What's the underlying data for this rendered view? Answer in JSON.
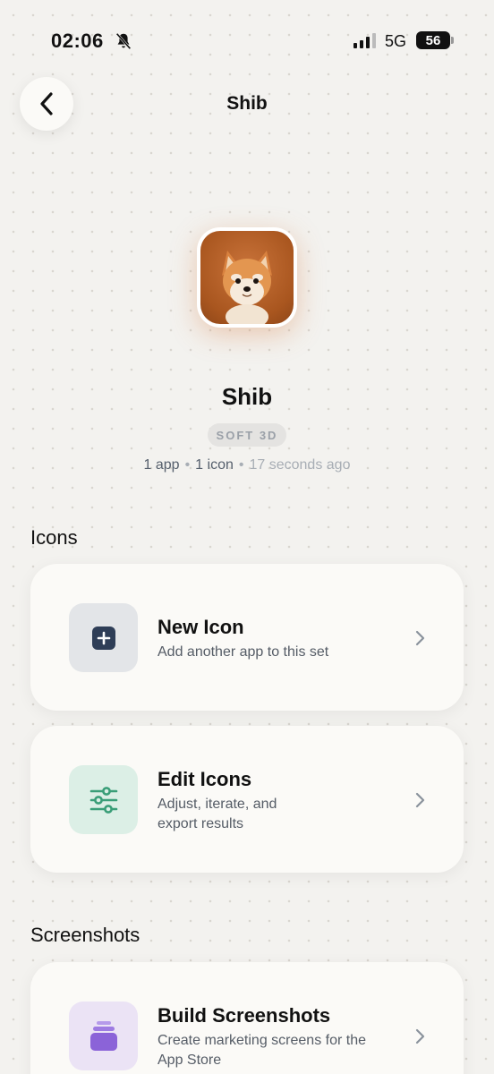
{
  "status": {
    "time": "02:06",
    "network": "5G",
    "battery": "56"
  },
  "nav": {
    "title": "Shib"
  },
  "app": {
    "name": "Shib",
    "style": "SOFT 3D",
    "apps": "1 app",
    "icons": "1 icon",
    "updated": "17 seconds ago"
  },
  "sections": {
    "icons_title": "Icons",
    "screenshots_title": "Screenshots"
  },
  "cards": {
    "new_icon": {
      "title": "New Icon",
      "subtitle": "Add another app to this set"
    },
    "edit_icons": {
      "title": "Edit Icons",
      "subtitle": "Adjust, iterate, and export results"
    },
    "build_screenshots": {
      "title": "Build Screenshots",
      "subtitle": "Create marketing screens for the App Store"
    }
  },
  "icons": {
    "back": "chevron-left-icon",
    "bell": "bell-slash-icon",
    "new_icon": "plus-square-icon",
    "edit_icons": "sliders-icon",
    "build_screenshots": "stack-icon",
    "chevron": "chevron-right-icon"
  },
  "colors": {
    "background": "#f3f2ef",
    "card": "#fbfaf7",
    "new_icon_tile": "#e3e5e8",
    "edit_icon_tile": "#dcefe6",
    "edit_icon_glyph": "#3a9e78",
    "screens_icon_tile": "#ebe3f5",
    "screens_icon_glyph": "#8b63d8"
  }
}
